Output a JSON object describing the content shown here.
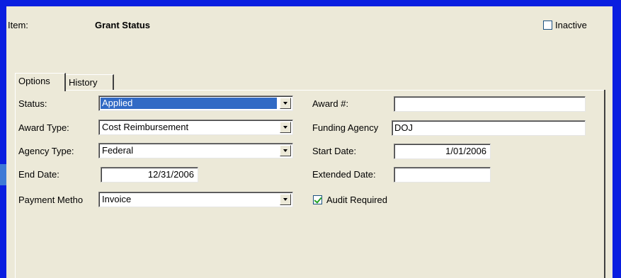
{
  "header": {
    "item_label": "Item:",
    "item_value": "Grant Status",
    "inactive_label": "Inactive",
    "inactive_checked": false
  },
  "tabs": [
    {
      "label": "Options",
      "active": true
    },
    {
      "label": "History",
      "active": false
    }
  ],
  "form": {
    "status": {
      "label": "Status:",
      "value": "Applied"
    },
    "award_type": {
      "label": "Award Type:",
      "value": "Cost Reimbursement"
    },
    "agency_type": {
      "label": "Agency Type:",
      "value": "Federal"
    },
    "end_date": {
      "label": "End Date:",
      "value": "12/31/2006"
    },
    "payment_method": {
      "label": "Payment Metho",
      "value": "Invoice"
    },
    "award_number": {
      "label": "Award #:",
      "value": ""
    },
    "funding_agency": {
      "label": "Funding Agency",
      "value": "DOJ"
    },
    "start_date": {
      "label": "Start Date:",
      "value": "1/01/2006"
    },
    "extended_date": {
      "label": "Extended Date:",
      "value": ""
    },
    "audit_required": {
      "label": "Audit Required",
      "checked": true
    }
  }
}
